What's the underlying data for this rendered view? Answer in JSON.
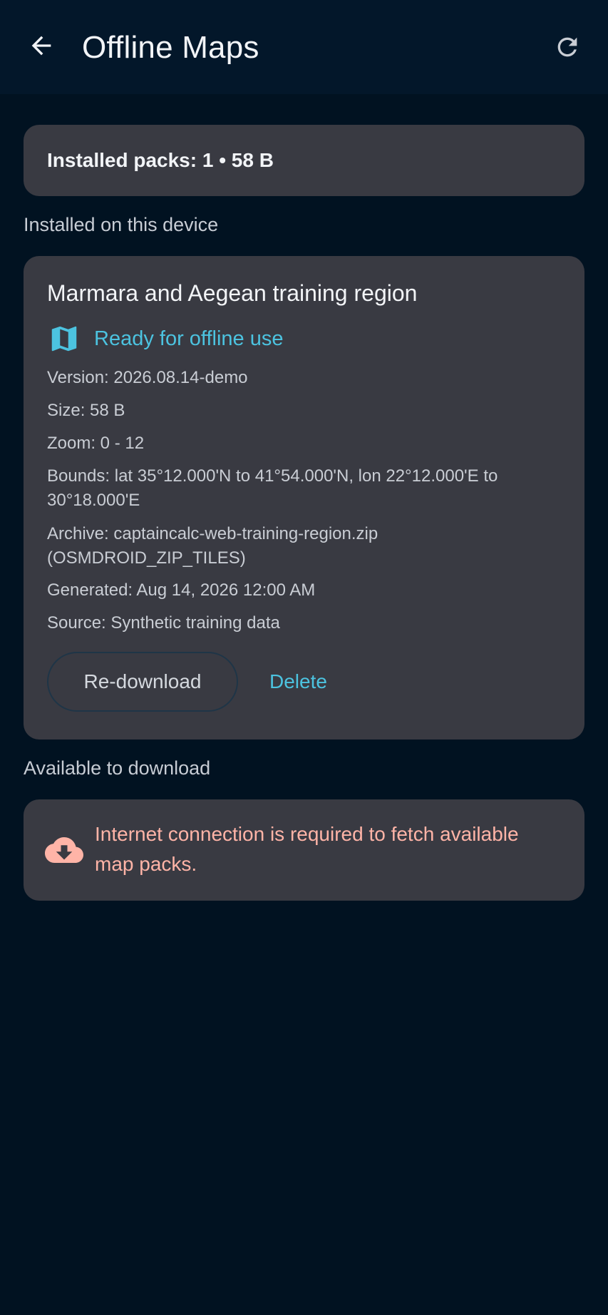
{
  "header": {
    "title": "Offline Maps",
    "back_icon": "arrow-back-icon",
    "refresh_icon": "refresh-icon"
  },
  "summary": {
    "text": "Installed packs: 1 • 58 B"
  },
  "installed_section": {
    "label": "Installed on this device"
  },
  "pack": {
    "name": "Marmara and Aegean training region",
    "status_icon": "map-icon",
    "status": "Ready for offline use",
    "version": "Version: 2026.08.14-demo",
    "size": "Size: 58 B",
    "zoom": "Zoom: 0 - 12",
    "bounds": "Bounds: lat 35°12.000'N to 41°54.000'N, lon 22°12.000'E to 30°18.000'E",
    "archive": "Archive: captaincalc-web-training-region.zip (OSMDROID_ZIP_TILES)",
    "generated": "Generated: Aug 14, 2026 12:00 AM",
    "source": "Source: Synthetic training data",
    "redownload_label": "Re-download",
    "delete_label": "Delete"
  },
  "available_section": {
    "label": "Available to download",
    "error_icon": "cloud-download-icon",
    "error_text": "Internet connection is required to fetch available map packs."
  },
  "colors": {
    "background": "#011221",
    "appbar": "#03172a",
    "card": "#393a42",
    "accent": "#4cc3e0",
    "error": "#ffb4a7"
  }
}
